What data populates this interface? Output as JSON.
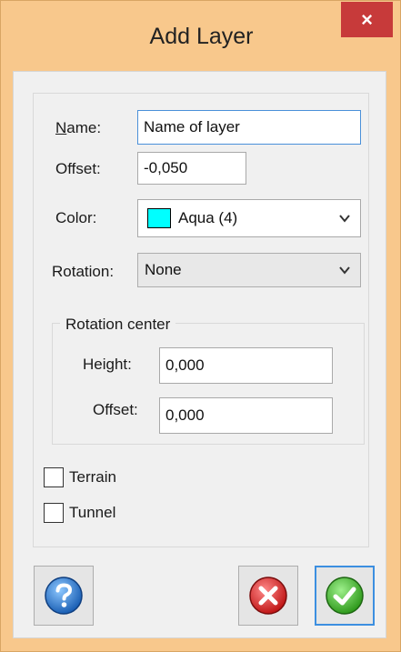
{
  "window": {
    "title": "Add Layer",
    "close_glyph": "×"
  },
  "form": {
    "name_label": "Name:",
    "name_label_first": "N",
    "name_label_rest": "ame:",
    "name_value": "Name of layer",
    "offset_label": "Offset:",
    "offset_value": "-0,050",
    "color_label": "Color:",
    "color_value": "Aqua (4)",
    "color_swatch": "#00ffff",
    "rotation_label": "Rotation:",
    "rotation_value": "None"
  },
  "rotation_center": {
    "legend": "Rotation center",
    "height_label": "Height:",
    "height_value": "0,000",
    "offset_label": "Offset:",
    "offset_value": "0,000"
  },
  "options": {
    "terrain_label": "Terrain",
    "terrain_checked": false,
    "tunnel_label": "Tunnel",
    "tunnel_checked": false
  },
  "buttons": {
    "help_icon": "help-icon",
    "cancel_icon": "cancel-icon",
    "ok_icon": "ok-icon"
  },
  "colors": {
    "title_bar": "#f8c88c",
    "close": "#c73a3a",
    "focus": "#4a90d9"
  }
}
